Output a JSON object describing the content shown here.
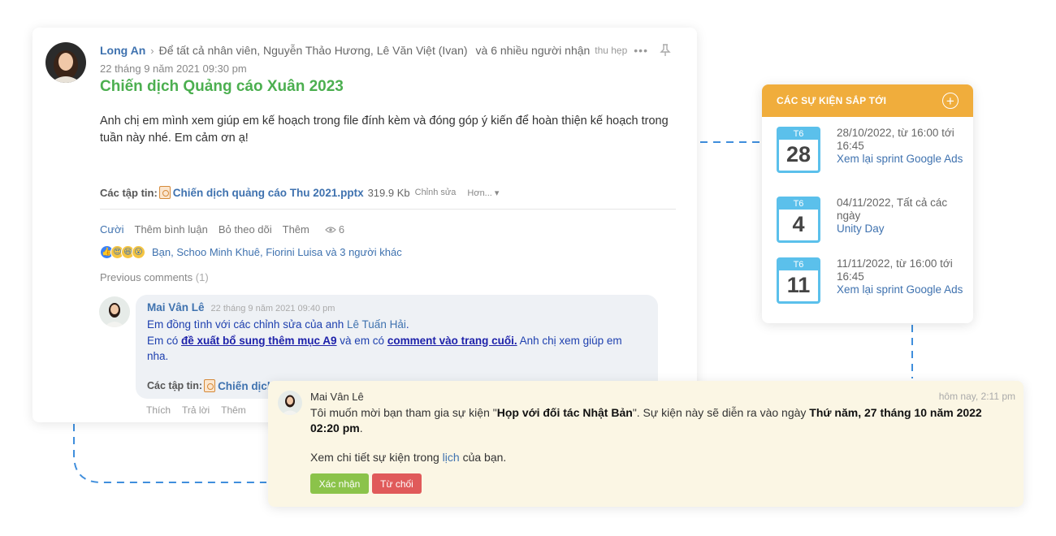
{
  "post": {
    "author": "Long An",
    "recipients": "Để tất cả nhân viên, Nguyễn Thảo Hương, Lê Văn Việt (Ivan)",
    "recipients_more": "và 6 nhiều người nhận",
    "collapse_label": "thu hẹp",
    "date": "22 tháng 9 năm 2021 09:30 pm",
    "title": "Chiến dịch Quảng cáo Xuân 2023",
    "body": "Anh chị em mình xem giúp em kế hoạch trong file đính kèm và đóng góp ý kiến để hoàn thiện kế hoạch trong tuần này nhé. Em cảm ơn ạ!",
    "attachments_label": "Các tập tin:",
    "file_name": "Chiến dịch quảng cáo Thu 2021.pptx",
    "file_size": "319.9 Kb",
    "file_edit": "Chỉnh sửa",
    "file_more": "Hơn...",
    "actions": {
      "like": "Cười",
      "comment": "Thêm bình luận",
      "unfollow": "Bỏ theo dõi",
      "more": "Thêm",
      "views": "6"
    },
    "reaction_text": "Bạn, Schoo Minh Khuê, Fiorini Luisa và 3 người khác",
    "previous_comments": "Previous comments",
    "previous_count": "(1)"
  },
  "comment": {
    "author": "Mai Vân Lê",
    "date": "22 tháng 9 năm 2021 09:40 pm",
    "line1_prefix": "Em đồng tình với các chỉnh sửa của anh ",
    "mention": "Lê Tuấn Hải",
    "line1_suffix": ".",
    "line2_a": "Em có ",
    "link1": "đề xuất bổ sung thêm mục A9",
    "line2_b": " và em có ",
    "link2": "comment vào trang cuối.",
    "line2_c": " Anh chị xem giúp em nha.",
    "attachments_label": "Các tập tin:",
    "file_name": "Chiến dịch",
    "actions": {
      "like": "Thích",
      "reply": "Trả lời",
      "more": "Thêm"
    }
  },
  "events": {
    "title": "CÁC SỰ KIỆN SẮP TỚI",
    "items": [
      {
        "weekday": "T6",
        "day": "28",
        "date": "28/10/2022, từ 16:00 tới 16:45",
        "name": "Xem lại sprint Google Ads"
      },
      {
        "weekday": "T6",
        "day": "4",
        "date": "04/11/2022, Tất cả các ngày",
        "name": "Unity Day"
      },
      {
        "weekday": "T6",
        "day": "11",
        "date": "11/11/2022, từ 16:00 tới 16:45",
        "name": "Xem lại sprint Google Ads"
      }
    ]
  },
  "notification": {
    "author": "Mai Vân Lê",
    "time": "hôm nay, 2:11 pm",
    "text_a": "Tôi muốn mời bạn tham gia sự kiện \"",
    "event_name": "Họp với đối tác Nhật Bản",
    "text_b": "\". Sự kiện này sẽ diễn ra vào ngày ",
    "event_date": "Thứ năm, 27 tháng 10 năm 2022 02:20 pm",
    "text_c": ".",
    "detail_a": "Xem chi tiết sự kiện trong ",
    "detail_link": "lịch",
    "detail_b": " của bạn.",
    "confirm": "Xác nhận",
    "decline": "Từ chối"
  },
  "colors": {
    "accent_blue": "#3f72af",
    "title_green": "#4caf50",
    "events_orange": "#f0ad3c",
    "calendar_blue": "#5bc0eb",
    "confirm_green": "#8bc34a",
    "decline_red": "#e05a5a"
  }
}
